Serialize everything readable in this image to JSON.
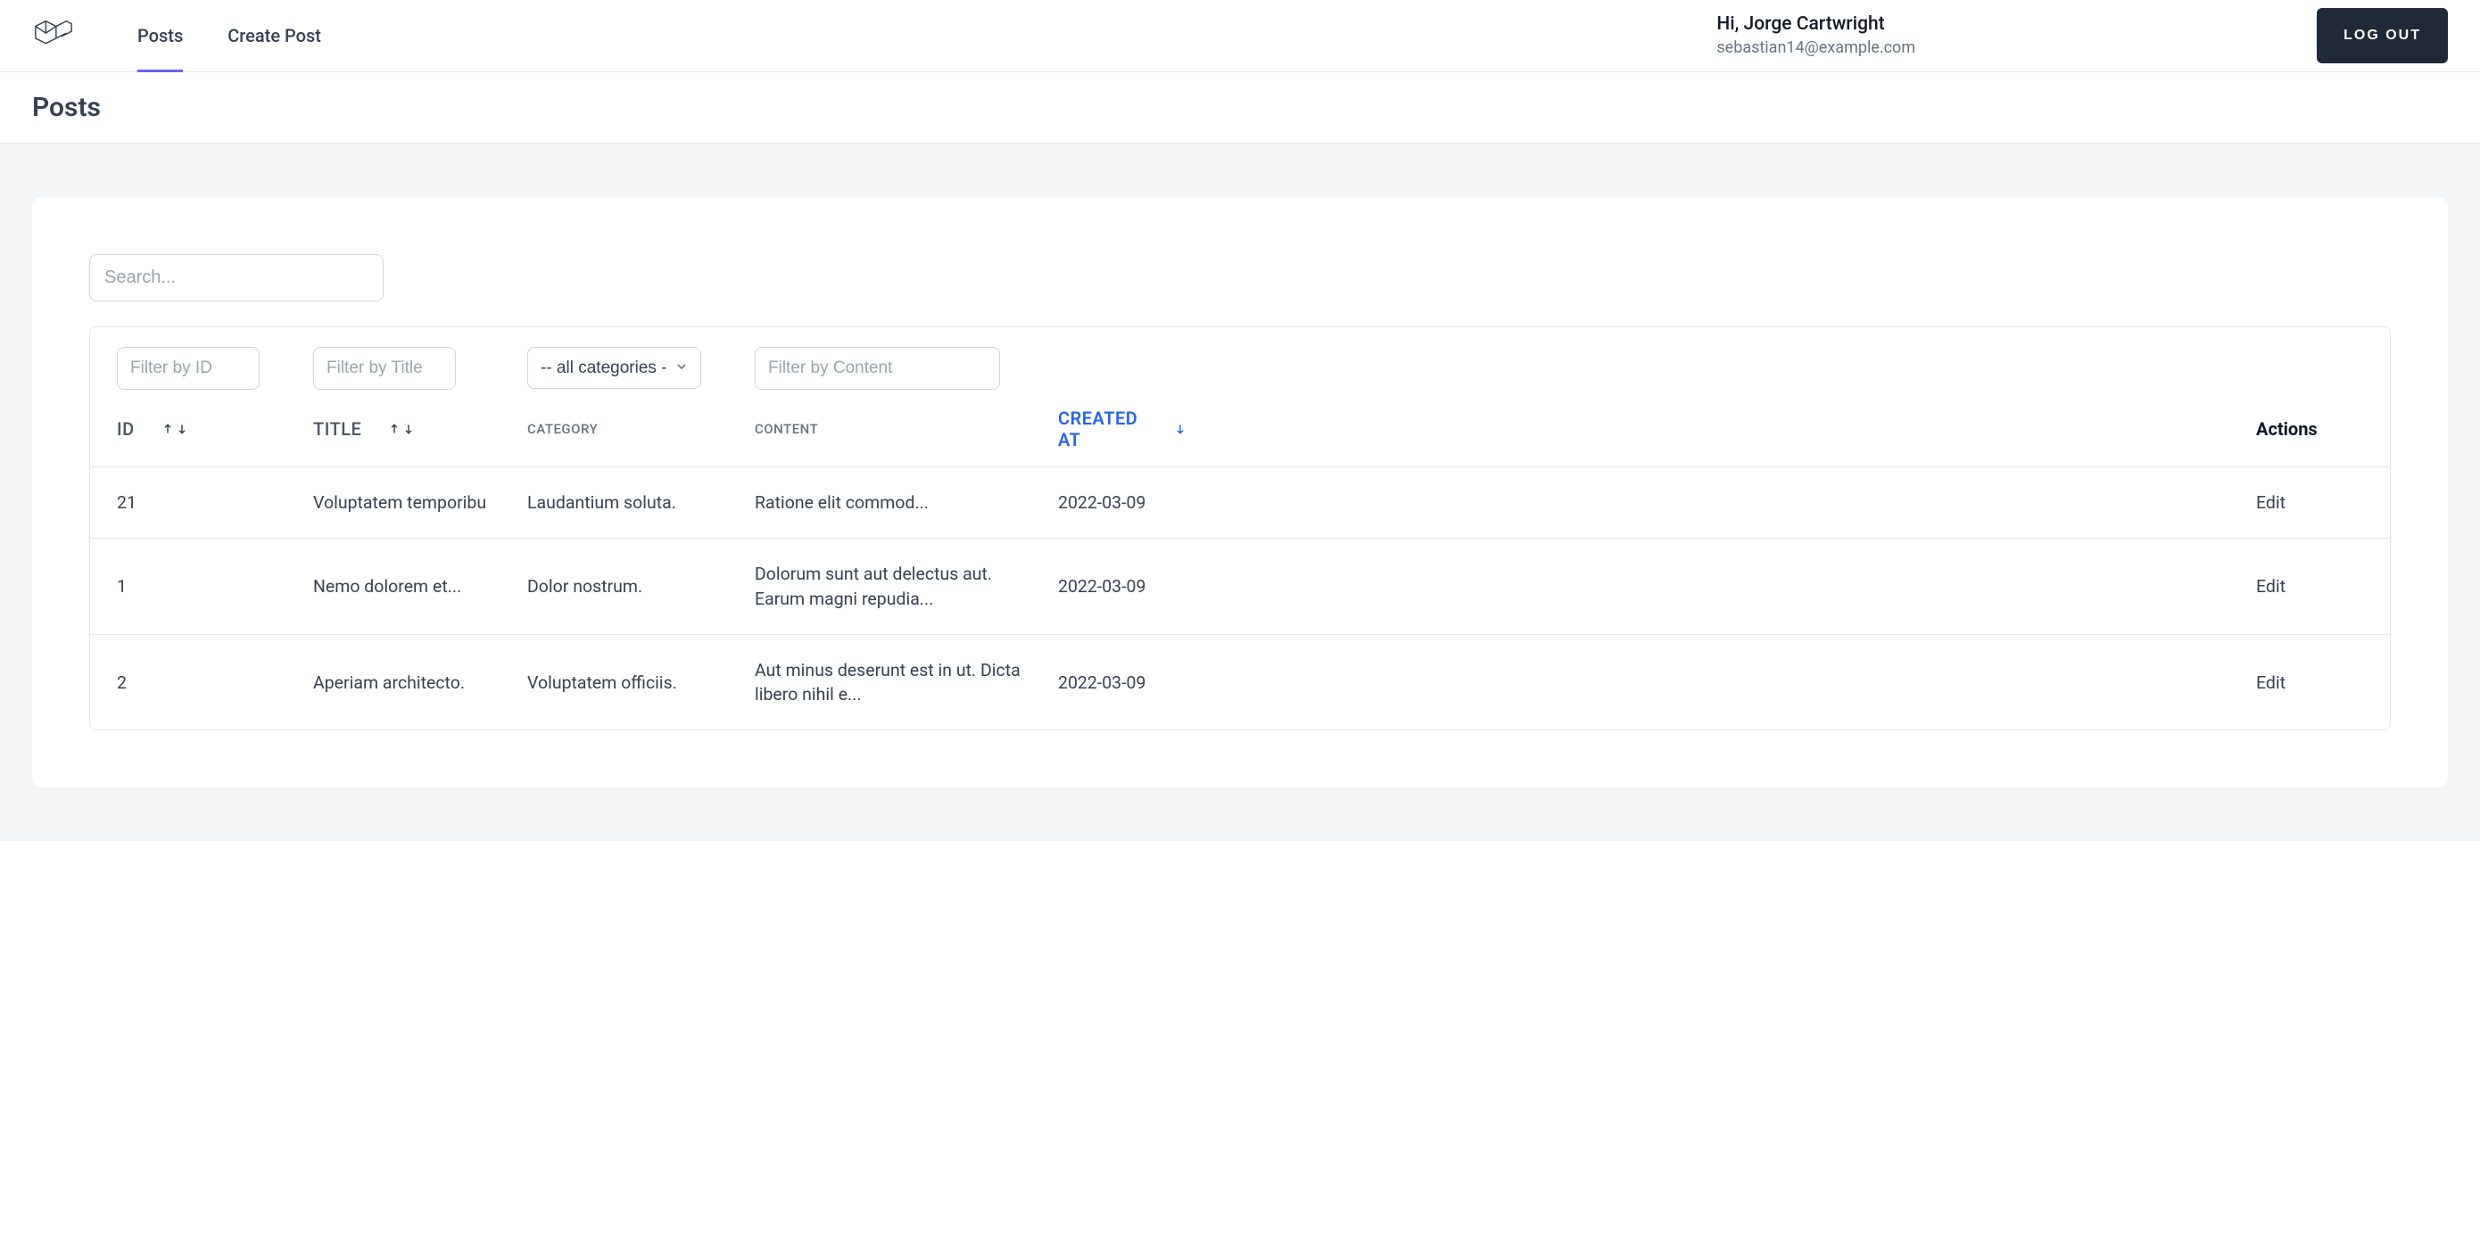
{
  "nav": {
    "posts": "Posts",
    "create_post": "Create Post"
  },
  "user": {
    "greeting": "Hi, Jorge Cartwright",
    "email": "sebastian14@example.com"
  },
  "logout_label": "LOG OUT",
  "page_title": "Posts",
  "search_placeholder": "Search...",
  "filters": {
    "id_placeholder": "Filter by ID",
    "title_placeholder": "Filter by Title",
    "category_selected": "-- all categories --",
    "content_placeholder": "Filter by Content"
  },
  "headers": {
    "id": "ID",
    "title": "TITLE",
    "category": "CATEGORY",
    "content": "CONTENT",
    "created_at": "CREATED AT",
    "actions": "Actions"
  },
  "rows": [
    {
      "id": "21",
      "title": "Voluptatem temporibu",
      "category": "Laudantium soluta.",
      "content": "Ratione elit commod...",
      "created_at": "2022-03-09",
      "action": "Edit"
    },
    {
      "id": "1",
      "title": "Nemo dolorem et...",
      "category": "Dolor nostrum.",
      "content": "Dolorum sunt aut delectus aut. Earum magni repudia...",
      "created_at": "2022-03-09",
      "action": "Edit"
    },
    {
      "id": "2",
      "title": "Aperiam architecto.",
      "category": "Voluptatem officiis.",
      "content": "Aut minus deserunt est in ut. Dicta libero nihil e...",
      "created_at": "2022-03-09",
      "action": "Edit"
    }
  ]
}
